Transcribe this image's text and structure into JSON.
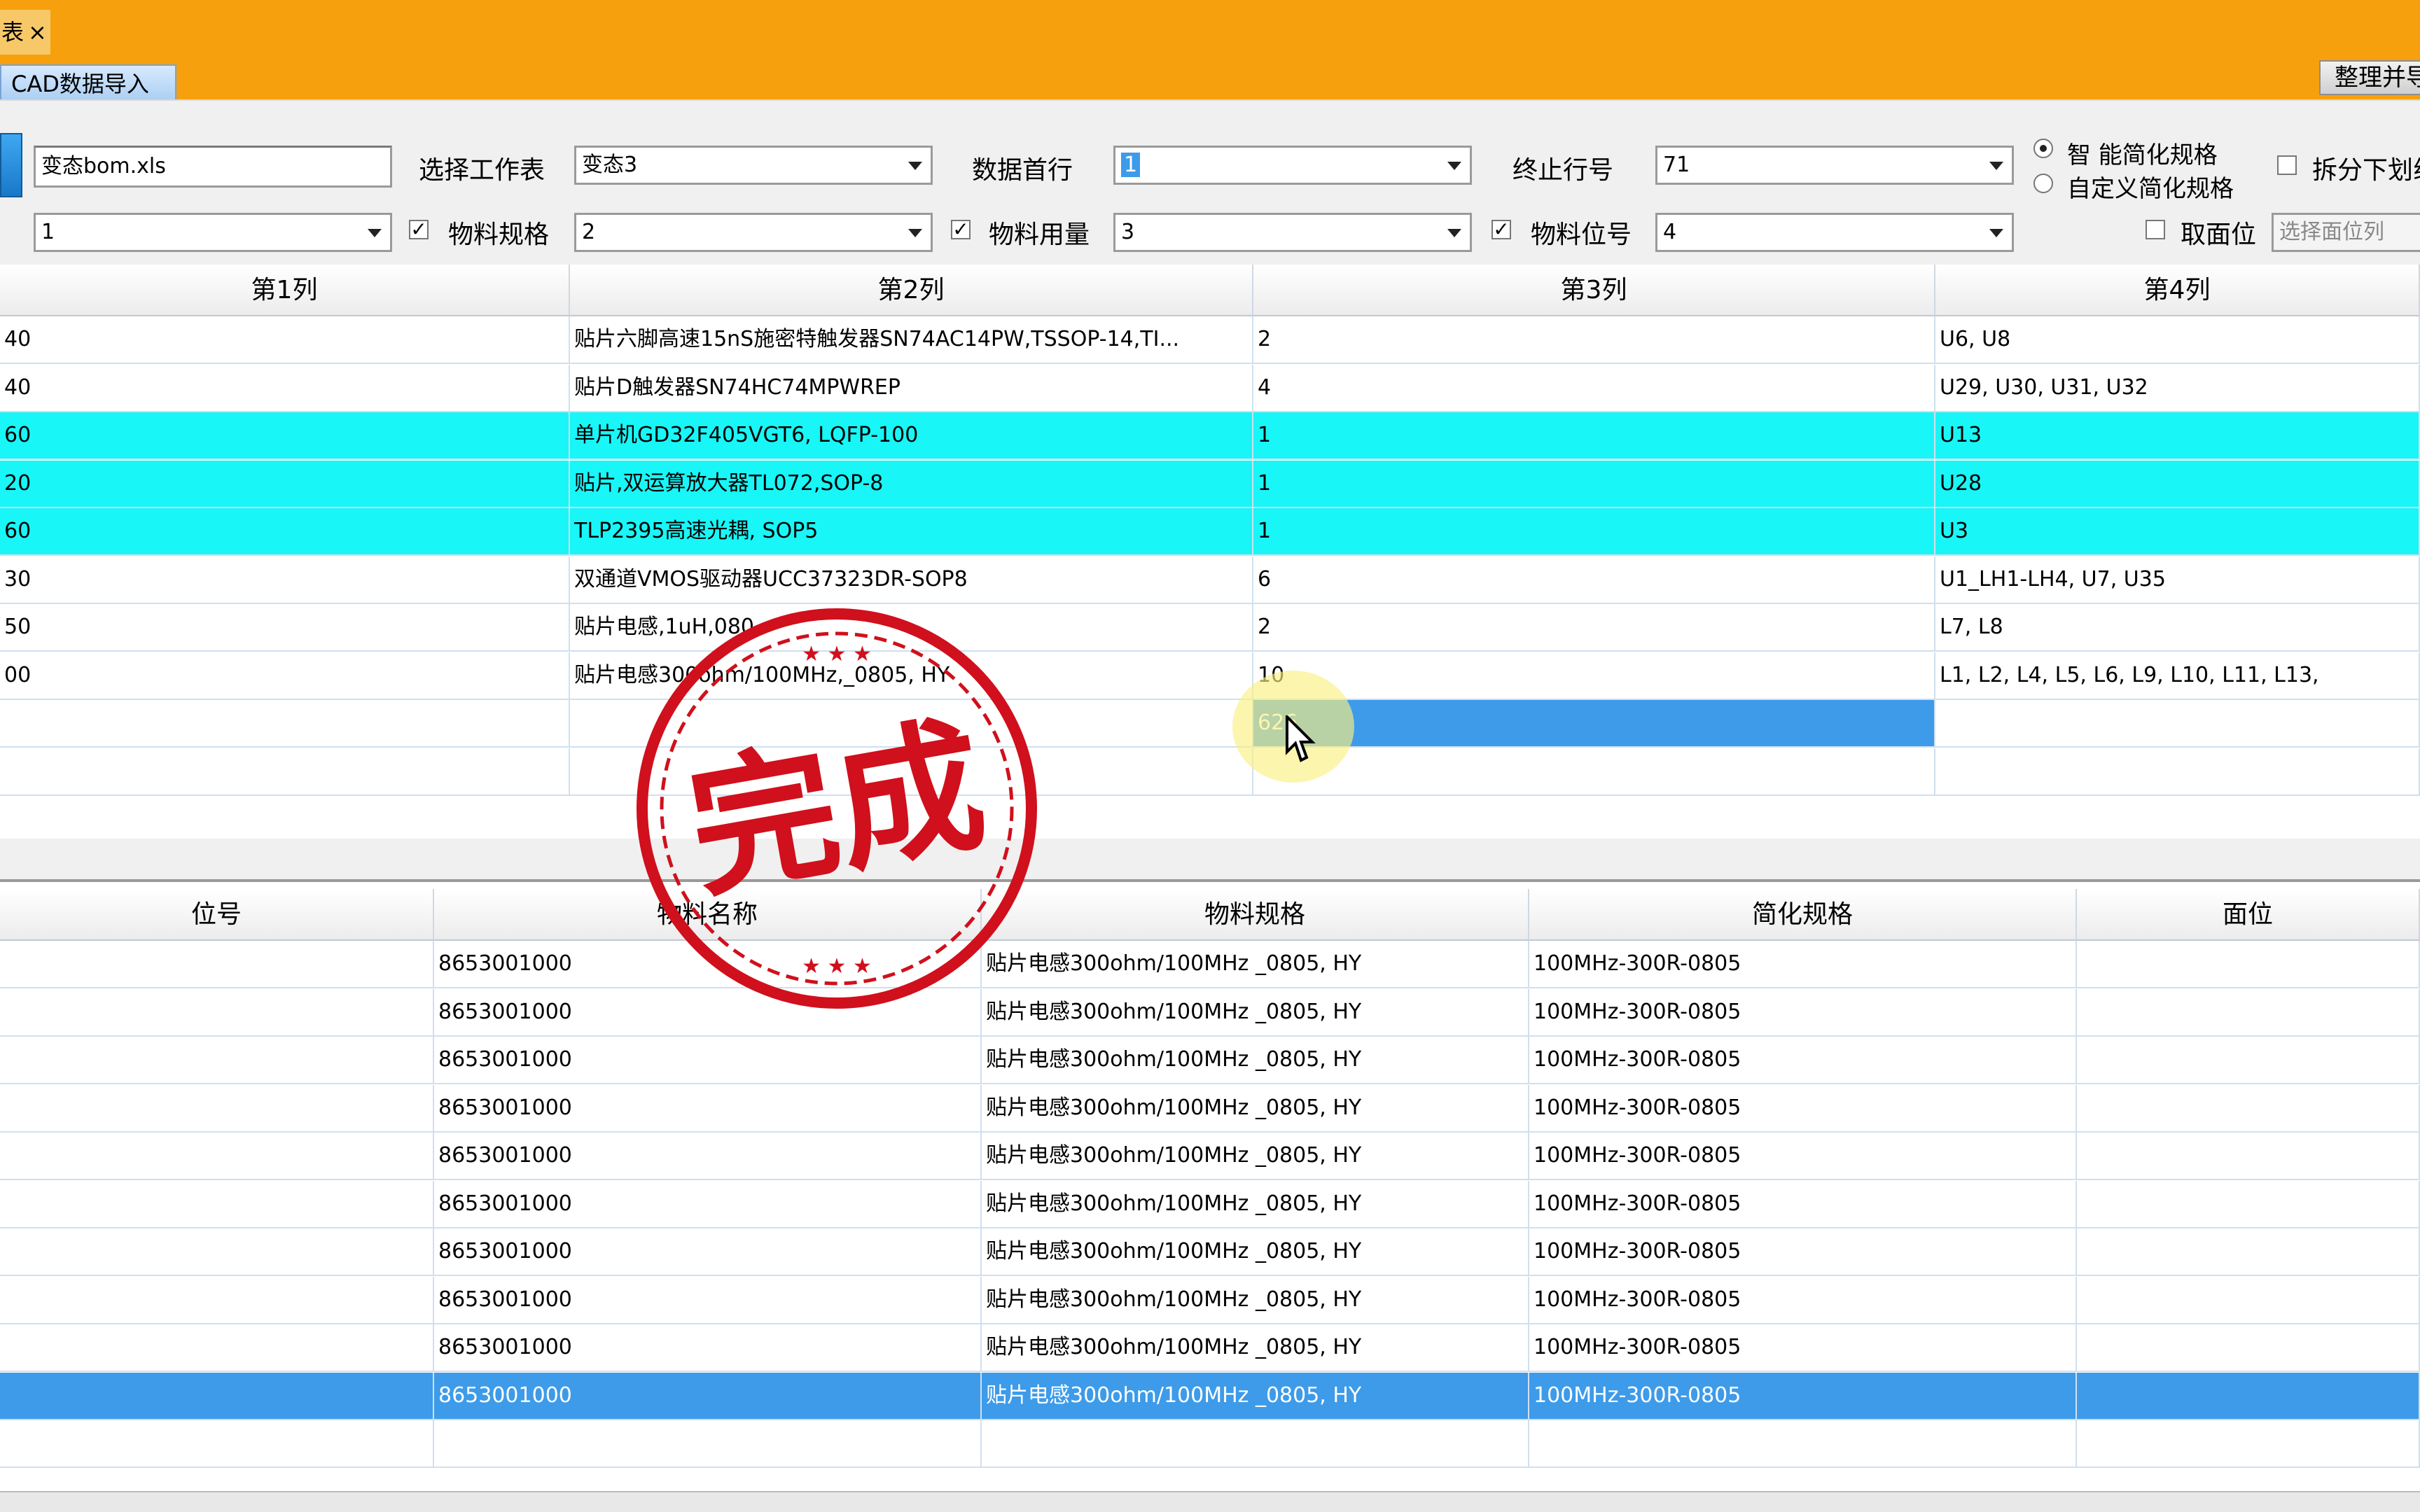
{
  "title_tab": {
    "label": "表",
    "close": "×"
  },
  "doc_tab": {
    "label": "CAD数据导入"
  },
  "top_button": {
    "label": "整理并导出"
  },
  "toolbar": {
    "file_input": "变态bom.xls",
    "sheet_label": "选择工作表",
    "sheet_value": "变态3",
    "first_row_label": "数据首行",
    "first_row_value": "1",
    "end_row_label": "终止行号",
    "end_row_value": "71",
    "radio_smart": "智   能简化规格",
    "radio_custom": "自定义简化规格",
    "split_label": "拆分下划线",
    "col_combo_1": "1",
    "spec_check_label": "物料规格",
    "spec_combo": "2",
    "qty_check_label": "物料用量",
    "qty_combo": "3",
    "pos_check_label": "物料位号",
    "pos_combo": "4",
    "side_check_label": "取面位",
    "side_column_placeholder": "选择面位列",
    "check_mark": "✓"
  },
  "grid1": {
    "headers": [
      "第1列",
      "第2列",
      "第3列",
      "第4列"
    ],
    "rows": [
      {
        "c1": "40",
        "c2": "贴片六脚高速15nS施密特触发器SN74AC14PW,TSSOP-14,TI...",
        "c3": "2",
        "c4": "U6, U8"
      },
      {
        "c1": "40",
        "c2": "贴片D触发器SN74HC74MPWREP",
        "c3": "4",
        "c4": "U29, U30, U31, U32"
      },
      {
        "c1": "60",
        "c2": "单片机GD32F405VGT6, LQFP-100",
        "c3": "1",
        "c4": "U13"
      },
      {
        "c1": "20",
        "c2": "贴片,双运算放大器TL072,SOP-8",
        "c3": "1",
        "c4": "U28"
      },
      {
        "c1": "60",
        "c2": "TLP2395高速光耦, SOP5",
        "c3": "1",
        "c4": "U3"
      },
      {
        "c1": "30",
        "c2": "双通道VMOS驱动器UCC37323DR-SOP8",
        "c3": "6",
        "c4": "U1_LH1-LH4, U7, U35"
      },
      {
        "c1": "50",
        "c2": "贴片电感,1uH,080",
        "c3": "2",
        "c4": "L7, L8"
      },
      {
        "c1": "00",
        "c2": "贴片电感300ohm/100MHz,_0805, HY",
        "c3": "10",
        "c4": "L1, L2, L4, L5, L6, L9, L10, L11, L13,"
      },
      {
        "c1": "",
        "c2": "",
        "c3": "626",
        "c4": ""
      }
    ]
  },
  "grid2": {
    "headers": [
      "位号",
      "物料名称",
      "物料规格",
      "简化规格",
      "面位"
    ],
    "rows": [
      {
        "pos": "",
        "name": "8653001000",
        "spec": "贴片电感300ohm/100MHz _0805, HY",
        "simple": "100MHz-300R-0805",
        "side": ""
      },
      {
        "pos": "",
        "name": "8653001000",
        "spec": "贴片电感300ohm/100MHz _0805, HY",
        "simple": "100MHz-300R-0805",
        "side": ""
      },
      {
        "pos": "",
        "name": "8653001000",
        "spec": "贴片电感300ohm/100MHz _0805, HY",
        "simple": "100MHz-300R-0805",
        "side": ""
      },
      {
        "pos": "",
        "name": "8653001000",
        "spec": "贴片电感300ohm/100MHz _0805, HY",
        "simple": "100MHz-300R-0805",
        "side": ""
      },
      {
        "pos": "",
        "name": "8653001000",
        "spec": "贴片电感300ohm/100MHz _0805, HY",
        "simple": "100MHz-300R-0805",
        "side": ""
      },
      {
        "pos": "",
        "name": "8653001000",
        "spec": "贴片电感300ohm/100MHz _0805, HY",
        "simple": "100MHz-300R-0805",
        "side": ""
      },
      {
        "pos": "",
        "name": "8653001000",
        "spec": "贴片电感300ohm/100MHz _0805, HY",
        "simple": "100MHz-300R-0805",
        "side": ""
      },
      {
        "pos": "",
        "name": "8653001000",
        "spec": "贴片电感300ohm/100MHz _0805, HY",
        "simple": "100MHz-300R-0805",
        "side": ""
      },
      {
        "pos": "",
        "name": "8653001000",
        "spec": "贴片电感300ohm/100MHz _0805, HY",
        "simple": "100MHz-300R-0805",
        "side": ""
      },
      {
        "pos": "",
        "name": "8653001000",
        "spec": "贴片电感300ohm/100MHz _0805, HY",
        "simple": "100MHz-300R-0805",
        "side": ""
      },
      {
        "pos": "",
        "name": "",
        "spec": "",
        "simple": "",
        "side": ""
      }
    ]
  },
  "stamp": {
    "text": "完成"
  },
  "colors": {
    "ribbon": "#f5a00c",
    "highlight_row": "#18f6f7",
    "selection": "#3d9be9",
    "stamp": "#d0101c"
  }
}
